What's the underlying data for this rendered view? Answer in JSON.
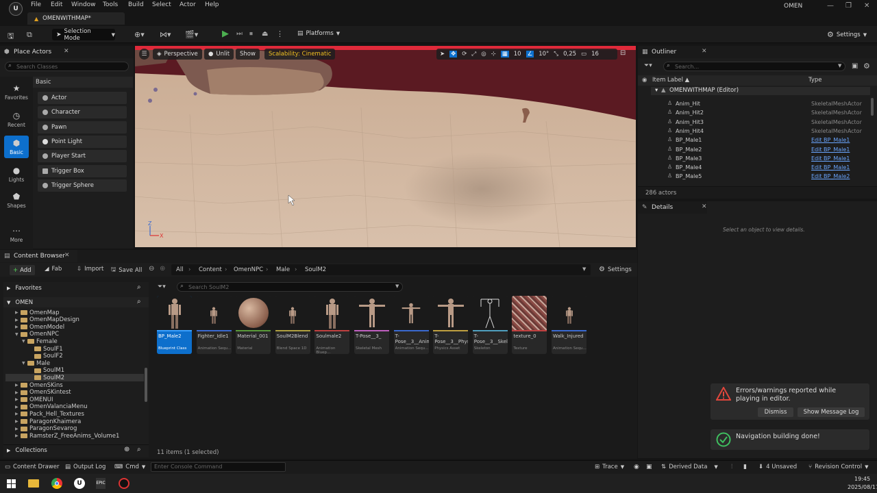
{
  "menu": {
    "items": [
      "File",
      "Edit",
      "Window",
      "Tools",
      "Build",
      "Select",
      "Actor",
      "Help"
    ],
    "app_name": "OMEN"
  },
  "tab": {
    "title": "OMENWITHMAP*"
  },
  "toolbar": {
    "selection_mode": "Selection Mode",
    "platforms": "Platforms",
    "settings": "Settings"
  },
  "place_actors": {
    "title": "Place Actors",
    "search_placeholder": "Search Classes",
    "section": "Basic",
    "categories": [
      {
        "label": "Favorites",
        "icon": "★"
      },
      {
        "label": "Recent",
        "icon": "◷"
      },
      {
        "label": "Basic",
        "icon": "⬢"
      },
      {
        "label": "Lights",
        "icon": "💡"
      },
      {
        "label": "Shapes",
        "icon": "▲"
      },
      {
        "label": "More",
        "icon": "⋯"
      }
    ],
    "items": [
      "Actor",
      "Character",
      "Pawn",
      "Point Light",
      "Player Start",
      "Trigger Box",
      "Trigger Sphere"
    ]
  },
  "viewport": {
    "perspective": "Perspective",
    "unlit": "Unlit",
    "show": "Show",
    "scalability": "Scalability: Cinematic",
    "grid_value": "10",
    "angle_value": "10°",
    "scale_value": "0,25",
    "camera_speed": "16"
  },
  "outliner": {
    "title": "Outliner",
    "search_placeholder": "Search...",
    "col_label": "Item Label ▲",
    "col_type": "Type",
    "root": "OMENWITHMAP (Editor)",
    "rows": [
      {
        "name": "Anim_Hit",
        "type": "SkeletalMeshActor",
        "link": false
      },
      {
        "name": "Anim_Hit2",
        "type": "SkeletalMeshActor",
        "link": false
      },
      {
        "name": "Anim_Hit3",
        "type": "SkeletalMeshActor",
        "link": false
      },
      {
        "name": "Anim_Hit4",
        "type": "SkeletalMeshActor",
        "link": false
      },
      {
        "name": "BP_Male1",
        "type": "Edit BP_Male1",
        "link": true
      },
      {
        "name": "BP_Male2",
        "type": "Edit BP_Male1",
        "link": true
      },
      {
        "name": "BP_Male3",
        "type": "Edit BP_Male1",
        "link": true
      },
      {
        "name": "BP_Male4",
        "type": "Edit BP_Male1",
        "link": true
      },
      {
        "name": "BP_Male5",
        "type": "Edit BP_Male2",
        "link": true
      }
    ],
    "count": "286 actors"
  },
  "details": {
    "title": "Details",
    "empty": "Select an object to view details."
  },
  "content_browser": {
    "title": "Content Browser",
    "add": "Add",
    "fab": "Fab",
    "import": "Import",
    "save_all": "Save All",
    "settings": "Settings",
    "breadcrumb": [
      "All",
      "Content",
      "OmenNPC",
      "Male",
      "SoulM2"
    ],
    "search_placeholder": "Search SoulM2",
    "favorites": "Favorites",
    "root": "OMEN",
    "tree": [
      {
        "label": "OmenMap",
        "indent": 1
      },
      {
        "label": "OmenMapDesign",
        "indent": 1
      },
      {
        "label": "OmenModel",
        "indent": 1
      },
      {
        "label": "OmenNPC",
        "indent": 1
      },
      {
        "label": "Female",
        "indent": 2
      },
      {
        "label": "SoulF1",
        "indent": 3
      },
      {
        "label": "SoulF2",
        "indent": 3
      },
      {
        "label": "Male",
        "indent": 2
      },
      {
        "label": "SoulM1",
        "indent": 3
      },
      {
        "label": "SoulM2",
        "indent": 3
      },
      {
        "label": "OmenSKins",
        "indent": 1
      },
      {
        "label": "OmenSKintest",
        "indent": 1
      },
      {
        "label": "OMENUI",
        "indent": 1
      },
      {
        "label": "OmenValanciaMenu",
        "indent": 1
      },
      {
        "label": "Pack_Hell_Textures",
        "indent": 1
      },
      {
        "label": "ParagonKhaimera",
        "indent": 1
      },
      {
        "label": "ParagonSevarog",
        "indent": 1
      },
      {
        "label": "RamsterZ_FreeAnims_Volume1",
        "indent": 1
      }
    ],
    "collections": "Collections",
    "assets": [
      {
        "name": "BP_Male2",
        "type": "Blueprint Class",
        "color": "#3aa0ff",
        "kind": "figure"
      },
      {
        "name": "Fighter_Idle1",
        "type": "Animation Sequ...",
        "color": "#3a6ad1",
        "kind": "figure-small"
      },
      {
        "name": "Material_001",
        "type": "Material",
        "color": "#5a9a3a",
        "kind": "sphere"
      },
      {
        "name": "SoulM2Blend",
        "type": "Blend Space 1D",
        "color": "#b0a040",
        "kind": "figure-small"
      },
      {
        "name": "Soulmale2",
        "type": "Animation Bluep...",
        "color": "#c04040",
        "kind": "figure"
      },
      {
        "name": "T-Pose__3_",
        "type": "Skeletal Mesh",
        "color": "#c060c0",
        "kind": "tpose"
      },
      {
        "name": "T-Pose__3__Anim",
        "type": "Animation Sequ...",
        "color": "#3a6ad1",
        "kind": "tpose-small"
      },
      {
        "name": "T-Pose__3__PhysicsAsset",
        "type": "Physics Asset",
        "color": "#c0a040",
        "kind": "tpose"
      },
      {
        "name": "T-Pose__3__Skeleton",
        "type": "Skeleton",
        "color": "#50a0c0",
        "kind": "skeleton"
      },
      {
        "name": "texture_0",
        "type": "Texture",
        "color": "#c04040",
        "kind": "texture"
      },
      {
        "name": "Walk_Injured",
        "type": "Animation Sequ...",
        "color": "#3a6ad1",
        "kind": "figure-small"
      }
    ],
    "item_count": "11 items (1 selected)"
  },
  "notifications": {
    "error_text": "Errors/warnings reported while playing in editor.",
    "dismiss": "Dismiss",
    "show_log": "Show Message Log",
    "nav_text": "Navigation building done!"
  },
  "statusbar": {
    "content_drawer": "Content Drawer",
    "output_log": "Output Log",
    "cmd": "Cmd",
    "console_placeholder": "Enter Console Command",
    "trace": "Trace",
    "derived_data": "Derived Data",
    "unsaved": "4 Unsaved",
    "revision": "Revision Control"
  },
  "taskbar": {
    "time": "19:45",
    "date": "2025/08/17"
  }
}
